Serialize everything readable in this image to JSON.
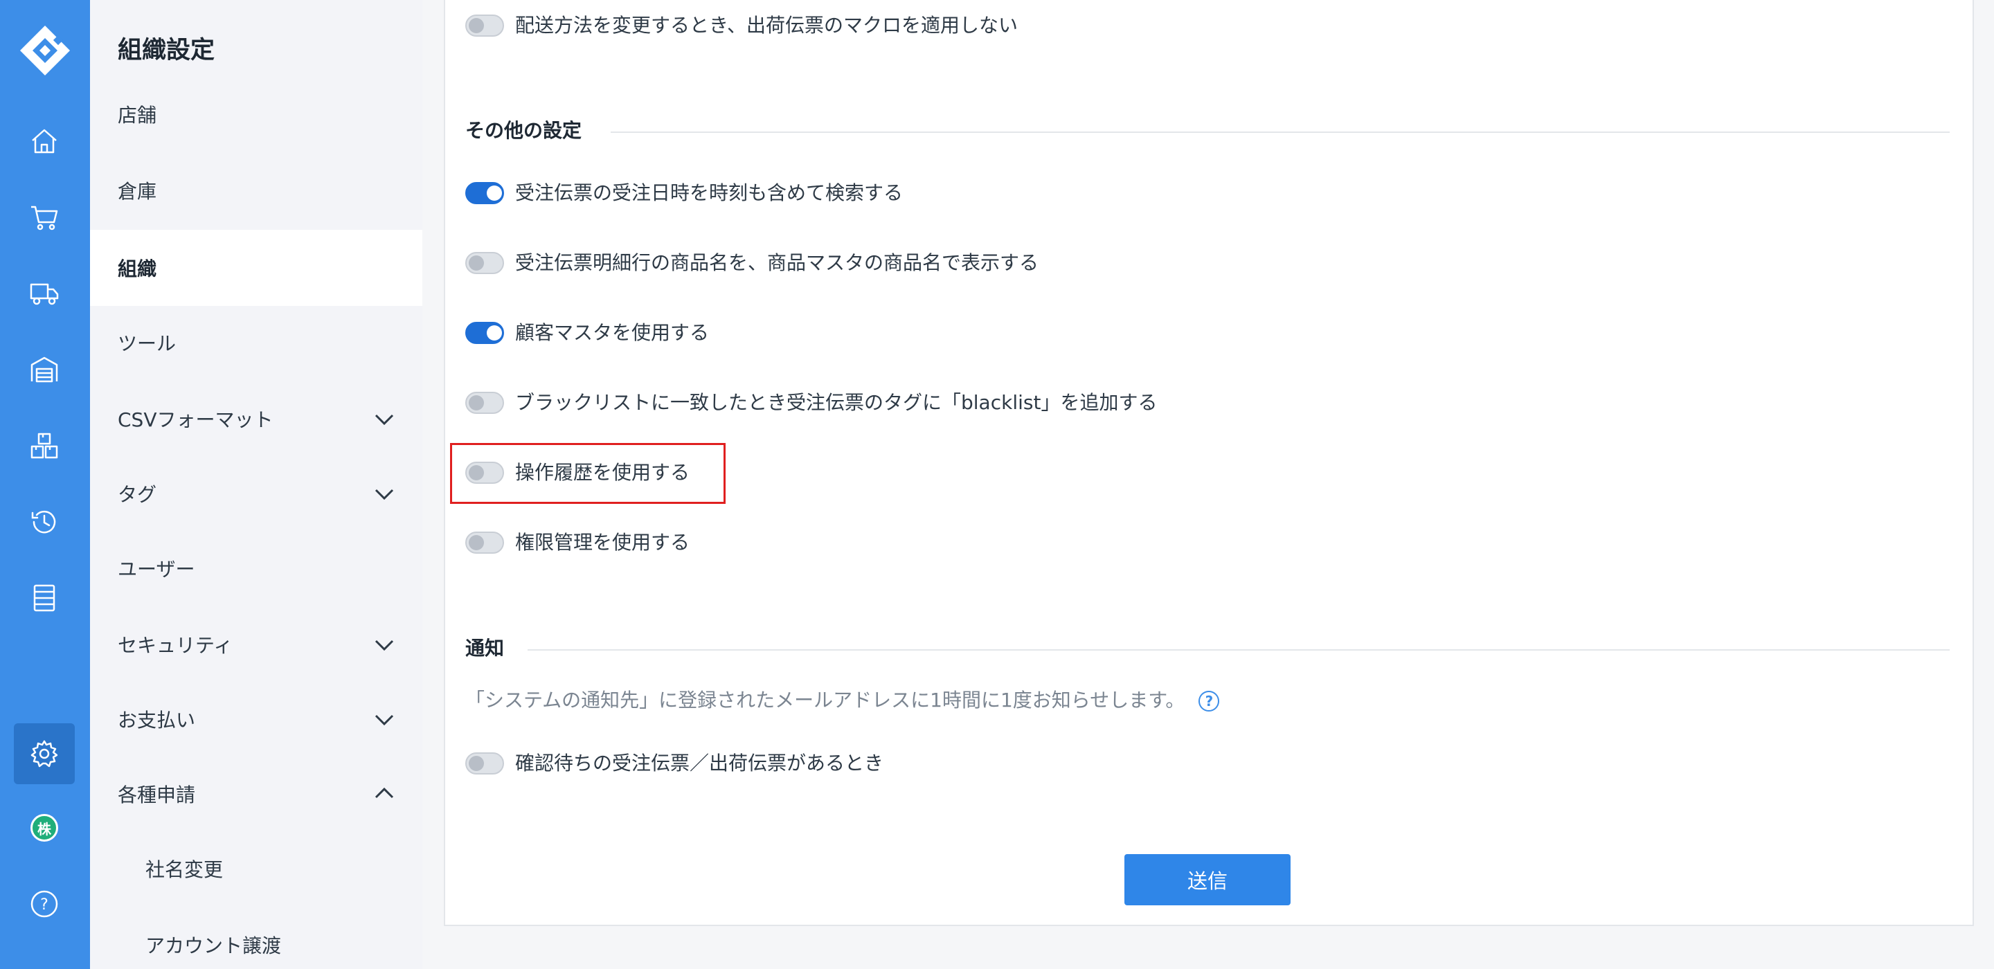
{
  "subnav": {
    "title": "組織設定",
    "items": [
      {
        "label": "店舗"
      },
      {
        "label": "倉庫"
      },
      {
        "label": "組織"
      },
      {
        "label": "ツール"
      },
      {
        "label": "CSVフォーマット"
      },
      {
        "label": "タグ"
      },
      {
        "label": "ユーザー"
      },
      {
        "label": "セキュリティ"
      },
      {
        "label": "お支払い"
      },
      {
        "label": "各種申請"
      },
      {
        "label": "社名変更"
      },
      {
        "label": "アカウント譲渡"
      }
    ]
  },
  "rail": {
    "badge": "株",
    "help": "?"
  },
  "settings": {
    "top_row": {
      "label": "配送方法を変更するとき、出荷伝票のマクロを適用しない",
      "on": false
    },
    "other": {
      "title": "その他の設定",
      "rows": [
        {
          "label": "受注伝票の受注日時を時刻も含めて検索する",
          "on": true
        },
        {
          "label": "受注伝票明細行の商品名を、商品マスタの商品名で表示する",
          "on": false
        },
        {
          "label": "顧客マスタを使用する",
          "on": true
        },
        {
          "label": "ブラックリストに一致したとき受注伝票のタグに「blacklist」を追加する",
          "on": false
        },
        {
          "label": "操作履歴を使用する",
          "on": false
        },
        {
          "label": "権限管理を使用する",
          "on": false
        }
      ]
    },
    "notify": {
      "title": "通知",
      "note": "「システムの通知先」に登録されたメールアドレスに1時間に1度お知らせします。",
      "help": "?",
      "rows": [
        {
          "label": "確認待ちの受注伝票／出荷伝票があるとき",
          "on": false
        }
      ]
    },
    "submit_label": "送信"
  },
  "colors": {
    "rail": "#3d8ee8",
    "toggle_on": "#1e6ed6",
    "highlight": "#e02020",
    "submit": "#2f86e8"
  }
}
